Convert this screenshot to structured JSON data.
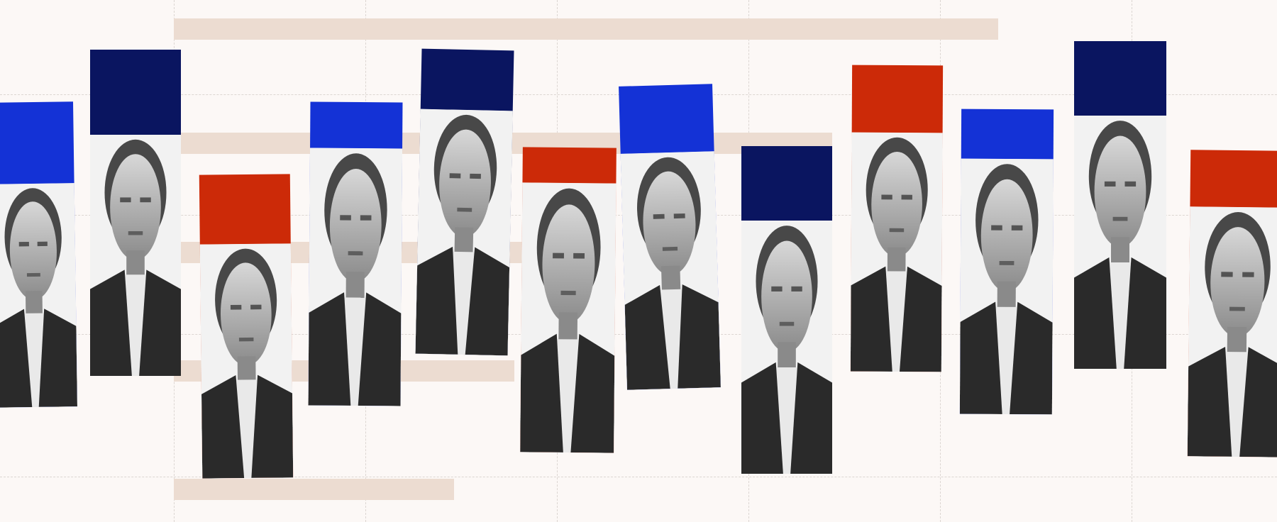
{
  "palette": {
    "background": "#fcf8f6",
    "bar_beige": "#ecdcd1",
    "blue": "#1432d6",
    "navy": "#0a1560",
    "red": "#cc2a08",
    "photo_dark": "#2a2a2a",
    "photo_mid": "#8a8a8a",
    "photo_light": "#d8d8d8"
  },
  "tiles": [
    {
      "id": "portrait-1",
      "color": "blue"
    },
    {
      "id": "portrait-2",
      "color": "navy"
    },
    {
      "id": "portrait-3",
      "color": "red"
    },
    {
      "id": "portrait-4",
      "color": "blue"
    },
    {
      "id": "portrait-5",
      "color": "navy"
    },
    {
      "id": "portrait-6",
      "color": "red"
    },
    {
      "id": "portrait-7",
      "color": "blue"
    },
    {
      "id": "portrait-8",
      "color": "navy"
    },
    {
      "id": "portrait-9",
      "color": "red"
    },
    {
      "id": "portrait-10",
      "color": "blue"
    },
    {
      "id": "portrait-11",
      "color": "navy"
    },
    {
      "id": "portrait-12",
      "color": "red"
    }
  ]
}
